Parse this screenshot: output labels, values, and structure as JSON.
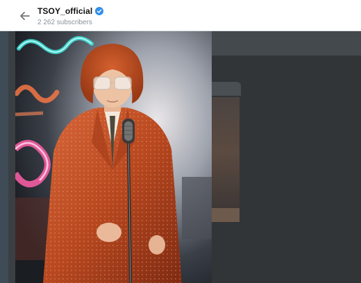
{
  "header": {
    "channel_title": "TSOY_official",
    "subscribers": "2 262 subscribers",
    "verified": true
  },
  "icons": {
    "back": "arrow-left-icon",
    "verified": "check-badge-icon"
  },
  "colors": {
    "accent": "#3390ec",
    "overlay": "#3a3f43",
    "suit": "#c8552a",
    "neon_pink": "#ff5fa8",
    "neon_cyan": "#3ee0d8"
  },
  "media": {
    "description_icon": "photo-performer"
  }
}
